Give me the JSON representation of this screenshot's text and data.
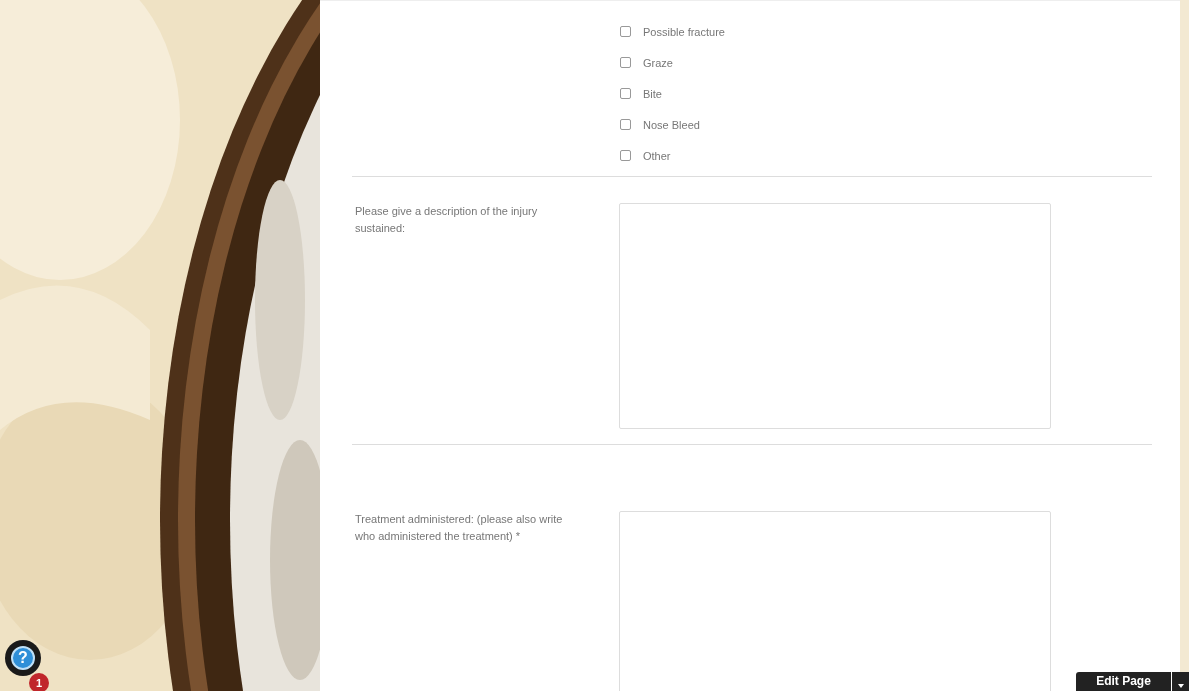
{
  "injury_types": [
    {
      "label": "Possible fracture",
      "checked": false
    },
    {
      "label": "Graze",
      "checked": false
    },
    {
      "label": "Bite",
      "checked": false
    },
    {
      "label": "Nose Bleed",
      "checked": false
    },
    {
      "label": "Other",
      "checked": false
    }
  ],
  "fields": [
    {
      "label": "Please give a description of the injury sustained:"
    },
    {
      "label": "Treatment administered: (please also write who administered the treatment) *"
    }
  ],
  "help_button": {
    "icon": "?",
    "badge": "1"
  },
  "edit_button": {
    "label": "Edit Page"
  }
}
